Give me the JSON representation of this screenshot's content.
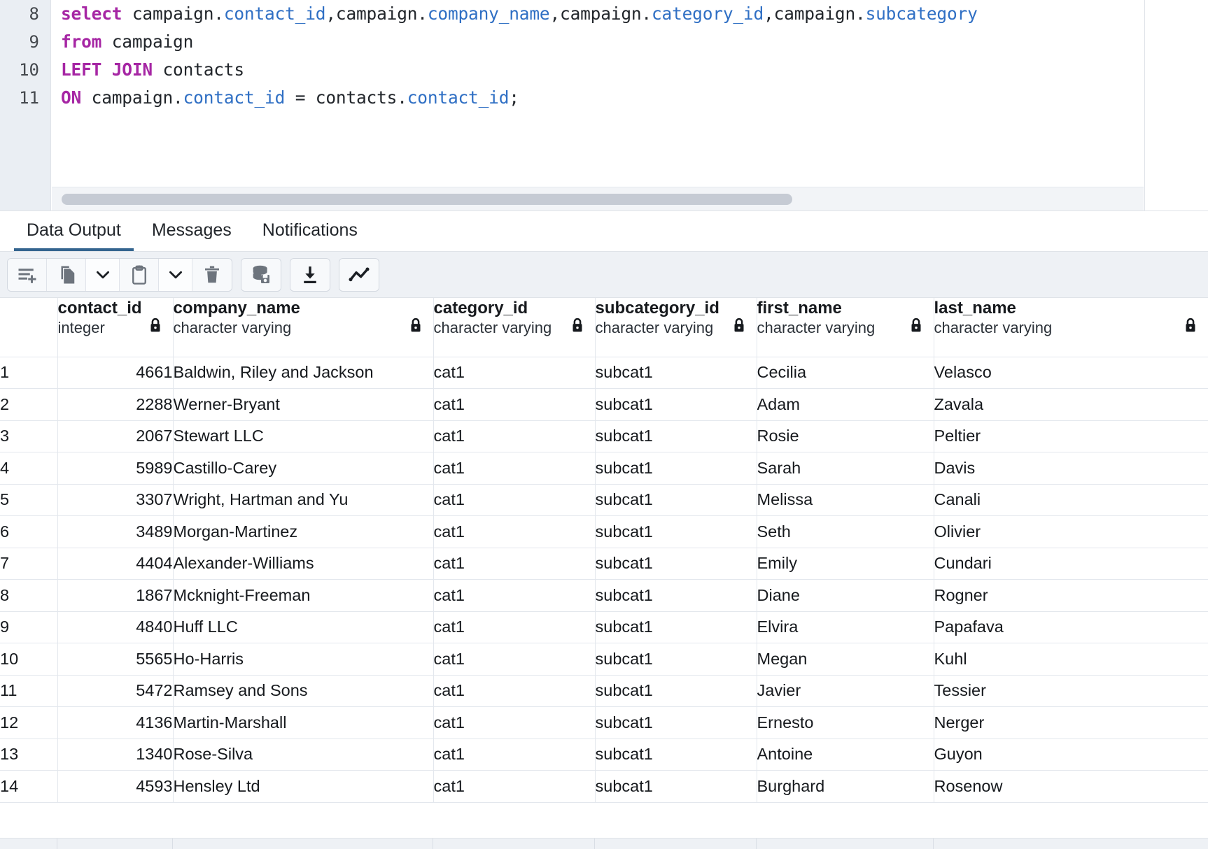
{
  "editor": {
    "lines": [
      {
        "number": "8",
        "tokens": [
          {
            "t": "select",
            "c": "kw"
          },
          {
            "t": " campaign.",
            "c": "pln"
          },
          {
            "t": "contact_id",
            "c": "fld"
          },
          {
            "t": ",campaign.",
            "c": "pln"
          },
          {
            "t": "company_name",
            "c": "fld"
          },
          {
            "t": ",campaign.",
            "c": "pln"
          },
          {
            "t": "category_id",
            "c": "fld"
          },
          {
            "t": ",campaign.",
            "c": "pln"
          },
          {
            "t": "subcategory",
            "c": "fld"
          }
        ]
      },
      {
        "number": "9",
        "tokens": [
          {
            "t": "from",
            "c": "kw"
          },
          {
            "t": " campaign",
            "c": "pln"
          }
        ]
      },
      {
        "number": "10",
        "tokens": [
          {
            "t": "LEFT JOIN",
            "c": "kw"
          },
          {
            "t": " contacts",
            "c": "pln"
          }
        ]
      },
      {
        "number": "11",
        "tokens": [
          {
            "t": "ON",
            "c": "kw"
          },
          {
            "t": " campaign.",
            "c": "pln"
          },
          {
            "t": "contact_id",
            "c": "fld"
          },
          {
            "t": " = contacts.",
            "c": "pln"
          },
          {
            "t": "contact_id",
            "c": "fld"
          },
          {
            "t": ";",
            "c": "pln"
          }
        ]
      }
    ],
    "accent_keyword_color": "#a626a4",
    "accent_field_color": "#2f6fc4"
  },
  "tabs": {
    "items": [
      {
        "label": "Data Output",
        "active": true
      },
      {
        "label": "Messages",
        "active": false
      },
      {
        "label": "Notifications",
        "active": false
      }
    ],
    "active_underline_color": "#34648f"
  },
  "toolbar": {
    "buttons": [
      {
        "name": "add-row-button",
        "icon": "add-row-icon",
        "state": "enabled-gray"
      },
      {
        "name": "copy-button",
        "icon": "copy-icon",
        "state": "enabled-gray"
      },
      {
        "name": "copy-options-button",
        "icon": "chevron-down-icon",
        "state": "enabled-gray"
      },
      {
        "name": "paste-button",
        "icon": "clipboard-icon",
        "state": "enabled-gray"
      },
      {
        "name": "paste-options-button",
        "icon": "chevron-down-icon",
        "state": "enabled-gray"
      },
      {
        "name": "delete-row-button",
        "icon": "trash-icon",
        "state": "enabled-gray"
      },
      {
        "name": "save-data-changes-button",
        "icon": "database-save-icon",
        "state": "enabled-gray"
      },
      {
        "name": "download-results-button",
        "icon": "download-icon",
        "state": "enabled-dark"
      },
      {
        "name": "graph-visualiser-button",
        "icon": "line-chart-icon",
        "state": "enabled-dark"
      }
    ]
  },
  "grid": {
    "columns": [
      {
        "name": "contact_id",
        "type": "integer",
        "locked": true,
        "align": "right"
      },
      {
        "name": "company_name",
        "type": "character varying",
        "locked": true,
        "align": "left"
      },
      {
        "name": "category_id",
        "type": "character varying",
        "locked": true,
        "align": "left"
      },
      {
        "name": "subcategory_id",
        "type": "character varying",
        "locked": true,
        "align": "left"
      },
      {
        "name": "first_name",
        "type": "character varying",
        "locked": true,
        "align": "left"
      },
      {
        "name": "last_name",
        "type": "character varying",
        "locked": true,
        "align": "left"
      }
    ],
    "rows": [
      {
        "n": "1",
        "cells": [
          "4661",
          "Baldwin, Riley and Jackson",
          "cat1",
          "subcat1",
          "Cecilia",
          "Velasco"
        ]
      },
      {
        "n": "2",
        "cells": [
          "2288",
          "Werner-Bryant",
          "cat1",
          "subcat1",
          "Adam",
          "Zavala"
        ]
      },
      {
        "n": "3",
        "cells": [
          "2067",
          "Stewart LLC",
          "cat1",
          "subcat1",
          "Rosie",
          "Peltier"
        ]
      },
      {
        "n": "4",
        "cells": [
          "5989",
          "Castillo-Carey",
          "cat1",
          "subcat1",
          "Sarah",
          "Davis"
        ]
      },
      {
        "n": "5",
        "cells": [
          "3307",
          "Wright, Hartman and Yu",
          "cat1",
          "subcat1",
          "Melissa",
          "Canali"
        ]
      },
      {
        "n": "6",
        "cells": [
          "3489",
          "Morgan-Martinez",
          "cat1",
          "subcat1",
          "Seth",
          "Olivier"
        ]
      },
      {
        "n": "7",
        "cells": [
          "4404",
          "Alexander-Williams",
          "cat1",
          "subcat1",
          "Emily",
          "Cundari"
        ]
      },
      {
        "n": "8",
        "cells": [
          "1867",
          "Mcknight-Freeman",
          "cat1",
          "subcat1",
          "Diane",
          "Rogner"
        ]
      },
      {
        "n": "9",
        "cells": [
          "4840",
          "Huff LLC",
          "cat1",
          "subcat1",
          "Elvira",
          "Papafava"
        ]
      },
      {
        "n": "10",
        "cells": [
          "5565",
          "Ho-Harris",
          "cat1",
          "subcat1",
          "Megan",
          "Kuhl"
        ]
      },
      {
        "n": "11",
        "cells": [
          "5472",
          "Ramsey and Sons",
          "cat1",
          "subcat1",
          "Javier",
          "Tessier"
        ]
      },
      {
        "n": "12",
        "cells": [
          "4136",
          "Martin-Marshall",
          "cat1",
          "subcat1",
          "Ernesto",
          "Nerger"
        ]
      },
      {
        "n": "13",
        "cells": [
          "1340",
          "Rose-Silva",
          "cat1",
          "subcat1",
          "Antoine",
          "Guyon"
        ]
      },
      {
        "n": "14",
        "cells": [
          "4593",
          "Hensley Ltd",
          "cat1",
          "subcat1",
          "Burghard",
          "Rosenow"
        ]
      }
    ]
  }
}
